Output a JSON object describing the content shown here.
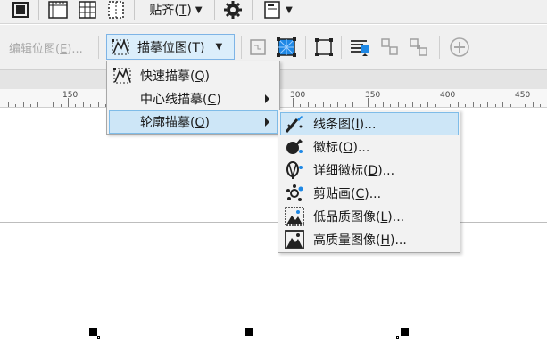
{
  "top_toolbar": {
    "snap_label": "贴齐(",
    "snap_key": "T",
    "snap_suffix": ")"
  },
  "property_bar": {
    "edit_bitmap": {
      "label": "编辑位图(",
      "key": "E",
      "suffix": ")..."
    },
    "trace_bitmap": {
      "label": "描摹位图(",
      "key": "T",
      "suffix": ")"
    }
  },
  "ruler": {
    "labels": [
      "150",
      "300",
      "350",
      "400",
      "450"
    ]
  },
  "trace_menu": {
    "items": [
      {
        "label": "快速描摹(",
        "key": "Q",
        "suffix": ")",
        "icon": "quick-trace-icon"
      },
      {
        "label": "中心线描摹(",
        "key": "C",
        "suffix": ")",
        "icon": "none"
      },
      {
        "label": "轮廓描摹(",
        "key": "O",
        "suffix": ")",
        "icon": "none"
      }
    ]
  },
  "outline_submenu": {
    "items": [
      {
        "label": "线条图(",
        "key": "I",
        "suffix": ")...",
        "icon": "line-art-icon"
      },
      {
        "label": "徽标(",
        "key": "O",
        "suffix": ")...",
        "icon": "logo-icon"
      },
      {
        "label": "详细徽标(",
        "key": "D",
        "suffix": ")...",
        "icon": "detailed-logo-icon"
      },
      {
        "label": "剪贴画(",
        "key": "C",
        "suffix": ")...",
        "icon": "clipart-icon"
      },
      {
        "label": "低品质图像(",
        "key": "L",
        "suffix": ")...",
        "icon": "low-quality-image-icon"
      },
      {
        "label": "高质量图像(",
        "key": "H",
        "suffix": ")...",
        "icon": "high-quality-image-icon"
      }
    ]
  },
  "colors": {
    "highlight_bg": "#cde6f7",
    "highlight_border": "#7fbce8",
    "ruler_accent": "#1e88e5"
  }
}
